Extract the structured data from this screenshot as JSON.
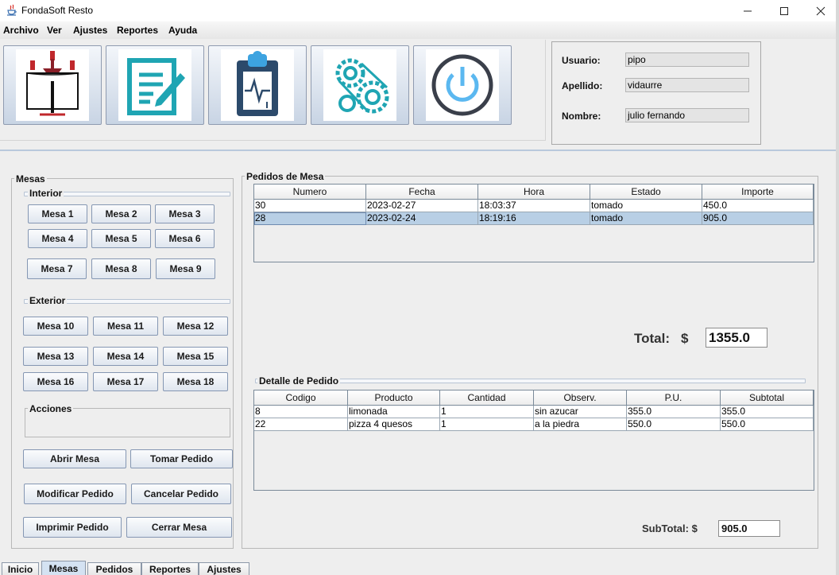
{
  "window": {
    "title": "FondaSoft Resto"
  },
  "menu": [
    "Archivo",
    "Ver",
    "Ajustes",
    "Reportes",
    "Ayuda"
  ],
  "toolbar": {
    "buttons": [
      {
        "name": "mesas-icon"
      },
      {
        "name": "pedido-icon"
      },
      {
        "name": "reporte-icon"
      },
      {
        "name": "ajustes-icon"
      },
      {
        "name": "salir-power-icon"
      }
    ]
  },
  "user": {
    "usuario_label": "Usuario:",
    "usuario_value": "pipo",
    "apellido_label": "Apellido:",
    "apellido_value": "vidaurre",
    "nombre_label": "Nombre:",
    "nombre_value": "julio fernando"
  },
  "mesas": {
    "title": "Mesas",
    "interior_title": "Interior",
    "interior": [
      "Mesa 1",
      "Mesa 2",
      "Mesa 3",
      "Mesa 4",
      "Mesa 5",
      "Mesa 6",
      "Mesa 7",
      "Mesa 8",
      "Mesa 9"
    ],
    "exterior_title": "Exterior",
    "exterior": [
      "Mesa 10",
      "Mesa 11",
      "Mesa 12",
      "Mesa 13",
      "Mesa 14",
      "Mesa 15",
      "Mesa 16",
      "Mesa 17",
      "Mesa 18"
    ],
    "acciones_title": "Acciones",
    "actions": [
      "Abrir Mesa",
      "Tomar Pedido",
      "Modificar Pedido",
      "Cancelar Pedido",
      "Imprimir Pedido",
      "Cerrar Mesa"
    ]
  },
  "pedidos": {
    "title": "Pedidos de Mesa",
    "columns": [
      "Numero",
      "Fecha",
      "Hora",
      "Estado",
      "Importe"
    ],
    "rows": [
      [
        "30",
        "2023-02-27",
        "18:03:37",
        "tomado",
        "450.0"
      ],
      [
        "28",
        "2023-02-24",
        "18:19:16",
        "tomado",
        "905.0"
      ]
    ],
    "selected_row": 1,
    "total_label": "Total:",
    "currency": "$",
    "total_value": "1355.0"
  },
  "detalle": {
    "title": "Detalle de Pedido",
    "columns": [
      "Codigo",
      "Producto",
      "Cantidad",
      "Observ.",
      "P.U.",
      "Subtotal"
    ],
    "rows": [
      [
        "8",
        "limonada",
        "1",
        "sin azucar",
        "355.0",
        "355.0"
      ],
      [
        "22",
        "pizza 4 quesos",
        "1",
        "a la piedra",
        "550.0",
        "550.0"
      ]
    ],
    "subtotal_label": "SubTotal: $",
    "subtotal_value": "905.0"
  },
  "tabs": [
    "Inicio",
    "Mesas",
    "Pedidos",
    "Reportes",
    "Ajustes"
  ],
  "active_tab": "Mesas",
  "colors": {
    "selection": "#b8cfe5",
    "button_gradient_bottom": "#dfe6ef",
    "accent_teal": "#1fa5b3"
  }
}
